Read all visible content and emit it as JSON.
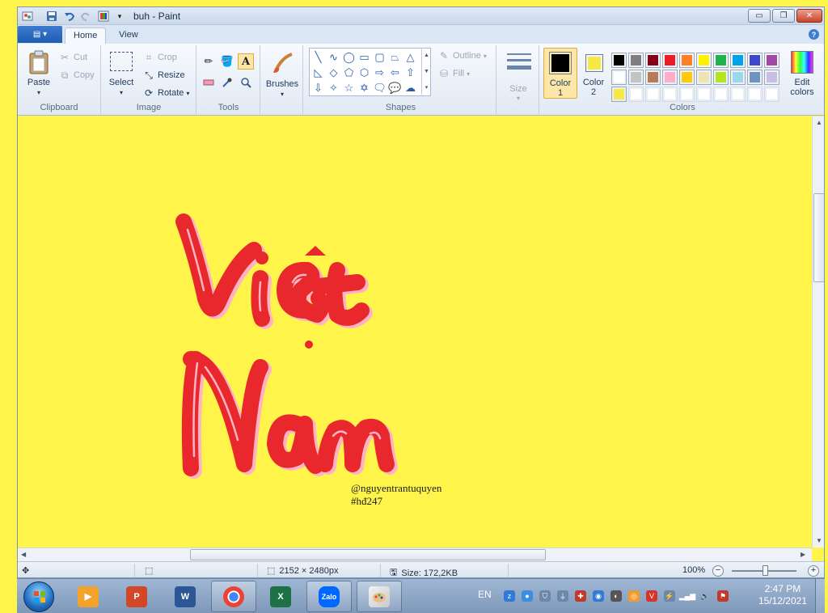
{
  "window": {
    "title": "buh - Paint",
    "min_label": "▭",
    "max_label": "❐",
    "close_label": "✕"
  },
  "tabs": {
    "app_menu": "▤ ▾",
    "home": "Home",
    "view": "View",
    "help": "?"
  },
  "ribbon": {
    "clipboard": {
      "label": "Clipboard",
      "paste": "Paste",
      "cut": "Cut",
      "copy": "Copy"
    },
    "image": {
      "label": "Image",
      "select": "Select",
      "crop": "Crop",
      "resize": "Resize",
      "rotate": "Rotate"
    },
    "tools": {
      "label": "Tools"
    },
    "brushes": {
      "label": "Brushes"
    },
    "shapes": {
      "label": "Shapes",
      "outline": "Outline",
      "fill": "Fill"
    },
    "size": {
      "label": "Size"
    },
    "colors": {
      "label": "Colors",
      "color1_line1": "Color",
      "color1_line2": "1",
      "color2_line1": "Color",
      "color2_line2": "2",
      "edit_line1": "Edit",
      "edit_line2": "colors",
      "color1": "#000000",
      "color2": "#f7e847",
      "palette_row1": [
        "#000000",
        "#7f7f7f",
        "#880015",
        "#ed1c24",
        "#ff7f27",
        "#fff200",
        "#22b14c",
        "#00a2e8",
        "#3f48cc",
        "#a349a4"
      ],
      "palette_row2": [
        "#ffffff",
        "#c3c3c3",
        "#b97a57",
        "#ffaec9",
        "#ffc90e",
        "#efe4b0",
        "#b5e61d",
        "#99d9ea",
        "#7092be",
        "#c8bfe7"
      ],
      "palette_row3": [
        "#f7e847",
        "",
        "",
        "",
        "",
        "",
        "",
        "",
        "",
        ""
      ]
    }
  },
  "canvas": {
    "watermark_line1": "@nguyentrantuquyen",
    "watermark_line2": "#hđ247",
    "art_color": "#e8282c",
    "art_highlight": "#ffb4c4",
    "background": "#fff44a"
  },
  "statusbar": {
    "dimensions": "2152 × 2480px",
    "size": "Size: 172,2KB",
    "zoom": "100%",
    "zoom_minus": "−",
    "zoom_plus": "+"
  },
  "taskbar": {
    "lang": "EN",
    "time": "2:47 PM",
    "date": "15/12/2021",
    "zalo_label": "Zalo"
  }
}
